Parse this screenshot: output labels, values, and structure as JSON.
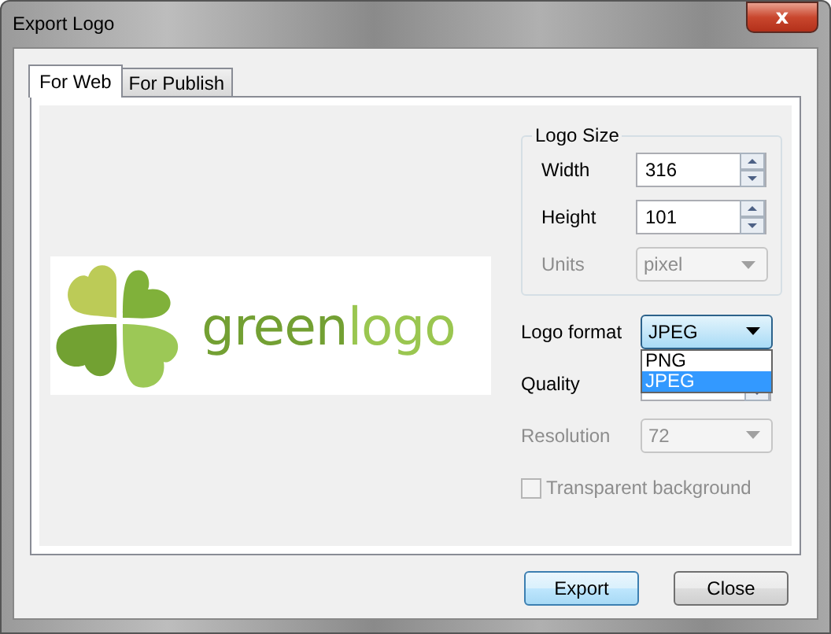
{
  "window": {
    "title": "Export Logo",
    "close": "x"
  },
  "tabs": [
    {
      "label": "For Web",
      "selected": true
    },
    {
      "label": "For Publish",
      "selected": false
    }
  ],
  "logo_preview": {
    "parts": [
      "green",
      "logo"
    ]
  },
  "logo_size": {
    "title": "Logo Size",
    "fields": [
      {
        "kind": "spin",
        "label": "Width",
        "value": "316",
        "disabled": false
      },
      {
        "kind": "spin",
        "label": "Height",
        "value": "101",
        "disabled": false
      },
      {
        "kind": "combo",
        "label": "Units",
        "value": "pixel",
        "disabled": true
      }
    ]
  },
  "settings": [
    {
      "kind": "combo",
      "label": "Logo format",
      "value": "JPEG",
      "disabled": false,
      "expanded": true,
      "options": [
        {
          "label": "PNG",
          "selected": false
        },
        {
          "label": "JPEG",
          "selected": true
        }
      ]
    },
    {
      "kind": "spin",
      "label": "Quality",
      "disabled": false
    },
    {
      "kind": "combo",
      "label": "Resolution",
      "value": "72",
      "disabled": true
    }
  ],
  "transparent": {
    "label": "Transparent background",
    "checked": false,
    "disabled": true
  },
  "buttons": [
    {
      "label": "Export",
      "default": true
    },
    {
      "label": "Close",
      "default": false
    }
  ]
}
